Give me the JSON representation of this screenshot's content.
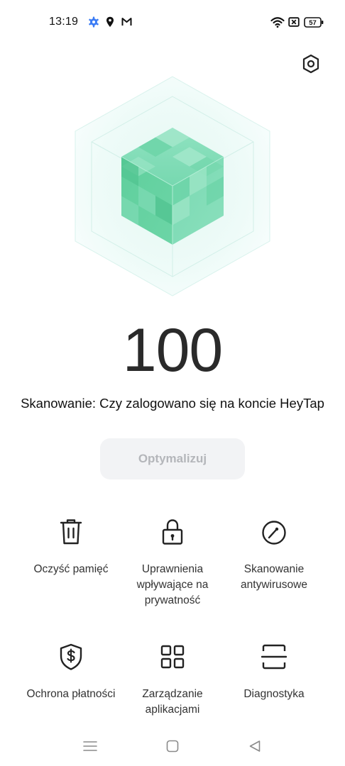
{
  "status_bar": {
    "time": "13:19",
    "left_icons": [
      "settings-gear-icon",
      "location-icon",
      "gmail-icon"
    ],
    "right_icons": [
      "wifi-icon",
      "no-sim-icon",
      "battery-icon"
    ],
    "battery_level": "57",
    "accent_color": "#3b7cf5"
  },
  "header": {
    "settings_icon": "hexagon-settings-icon"
  },
  "hero": {
    "image": "green-cube-in-hexagon",
    "colors": {
      "cube": "#6fd6a8",
      "glow": "#e6f8f4"
    }
  },
  "score": {
    "value": "100"
  },
  "scan": {
    "status_text": "Skanowanie: Czy zalogowano się na koncie HeyTap"
  },
  "optimize": {
    "label": "Optymalizuj",
    "enabled": false
  },
  "tools": [
    {
      "label": "Oczyść pamięć",
      "icon": "trash-icon"
    },
    {
      "label": "Uprawnienia wpływające na prywatność",
      "icon": "lock-icon"
    },
    {
      "label": "Skanowanie antywirusowe",
      "icon": "gauge-icon"
    },
    {
      "label": "Ochrona płatności",
      "icon": "shield-dollar-icon"
    },
    {
      "label": "Zarządzanie aplikacjami",
      "icon": "grid-apps-icon"
    },
    {
      "label": "Diagnostyka",
      "icon": "scan-frame-icon"
    }
  ],
  "nav_bar": {
    "buttons": [
      "menu-icon",
      "home-icon",
      "back-icon"
    ]
  }
}
